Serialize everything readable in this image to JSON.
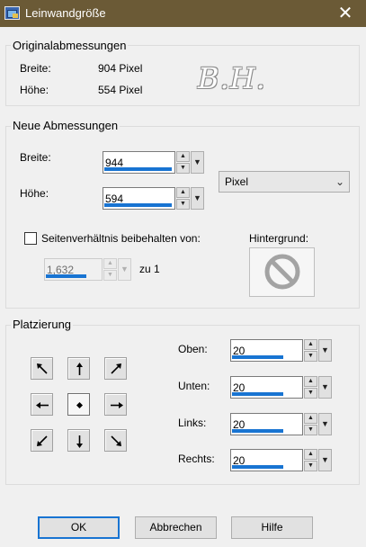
{
  "window": {
    "title": "Leinwandgröße",
    "close_glyph": "✕"
  },
  "original": {
    "legend": "Originalabmessungen",
    "width_label": "Breite:",
    "width_value": "904 Pixel",
    "height_label": "Höhe:",
    "height_value": "554 Pixel",
    "watermark": "B.H."
  },
  "new_dims": {
    "legend": "Neue Abmessungen",
    "width_label": "Breite:",
    "width_value": "944",
    "width_bar_fraction": 0.95,
    "height_label": "Höhe:",
    "height_value": "594",
    "height_bar_fraction": 0.95,
    "unit_selected": "Pixel",
    "keep_ratio_label": "Seitenverhältnis beibehalten von:",
    "keep_ratio_checked": false,
    "ratio_value": "1,632",
    "ratio_bar_fraction": 0.72,
    "ratio_suffix": "zu 1",
    "background_label": "Hintergrund:",
    "background_icon": "no-sign-icon"
  },
  "placement": {
    "legend": "Platzierung",
    "grid_icons": [
      "arrow-up-left-icon",
      "arrow-up-icon",
      "arrow-up-right-icon",
      "arrow-left-icon",
      "center-dot-icon",
      "arrow-right-icon",
      "arrow-down-left-icon",
      "arrow-down-icon",
      "arrow-down-right-icon"
    ],
    "selected_cell": "center",
    "fields": [
      {
        "label": "Oben:",
        "value": "20",
        "bar_fraction": 0.72
      },
      {
        "label": "Unten:",
        "value": "20",
        "bar_fraction": 0.72
      },
      {
        "label": "Links:",
        "value": "20",
        "bar_fraction": 0.72
      },
      {
        "label": "Rechts:",
        "value": "20",
        "bar_fraction": 0.72
      }
    ]
  },
  "buttons": {
    "ok": "OK",
    "cancel": "Abbrechen",
    "help": "Hilfe"
  },
  "colors": {
    "titlebar": "#6b5a36",
    "accent": "#1874d2",
    "dialog_bg": "#f0f0f0"
  }
}
